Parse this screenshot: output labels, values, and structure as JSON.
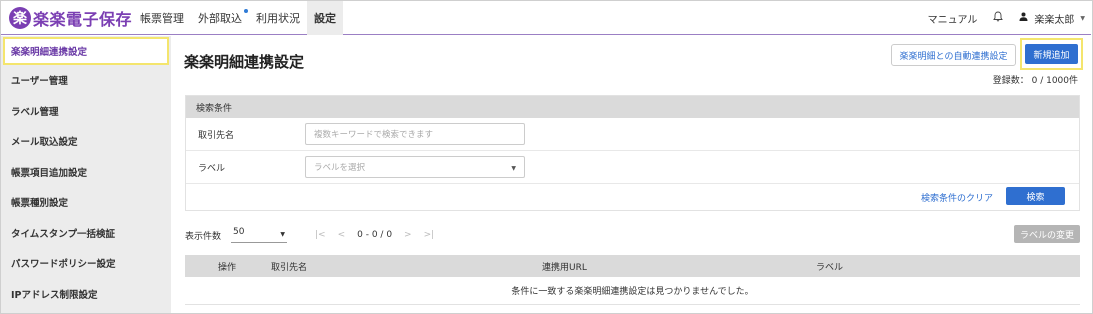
{
  "app": {
    "logo_mark": "楽",
    "logo_text": "楽楽電子保存",
    "brand_color": "#7b3fb3",
    "accent_color": "#2f6fd0"
  },
  "nav": {
    "items": [
      {
        "label": "帳票管理",
        "active": false
      },
      {
        "label": "外部取込",
        "active": false,
        "badge": true
      },
      {
        "label": "利用状況",
        "active": false
      },
      {
        "label": "設定",
        "active": true
      }
    ]
  },
  "topright": {
    "manual": "マニュアル",
    "bell_icon": "bell-icon",
    "user_icon": "user-icon",
    "user_name": "楽楽太郎"
  },
  "sidebar": {
    "items": [
      {
        "label": "楽楽明細連携設定",
        "active": true
      },
      {
        "label": "ユーザー管理"
      },
      {
        "label": "ラベル管理"
      },
      {
        "label": "メール取込設定"
      },
      {
        "label": "帳票項目追加設定"
      },
      {
        "label": "帳票種別設定"
      },
      {
        "label": "タイムスタンプ一括検証"
      },
      {
        "label": "パスワードポリシー設定"
      },
      {
        "label": "IPアドレス制限設定"
      }
    ]
  },
  "main": {
    "title": "楽楽明細連携設定",
    "auto_button": "楽楽明細との自動連携設定",
    "new_button": "新規追加",
    "count": "登録数： 0 / 1000件"
  },
  "search": {
    "heading": "検索条件",
    "partner_label": "取引先名",
    "partner_placeholder": "複数キーワードで検索できます",
    "label_label": "ラベル",
    "label_placeholder": "ラベルを選択",
    "clear": "検索条件のクリア",
    "submit": "検索"
  },
  "pager": {
    "per_page_label": "表示件数",
    "per_page_value": "50",
    "first": "|<",
    "prev": "<",
    "info": "0 - 0 / 0",
    "next": ">",
    "last": ">|",
    "label_change": "ラベルの変更"
  },
  "table": {
    "headers": [
      "操作",
      "取引先名",
      "連携用URL",
      "ラベル"
    ],
    "empty_message": "条件に一致する楽楽明細連携設定は見つかりませんでした。"
  }
}
